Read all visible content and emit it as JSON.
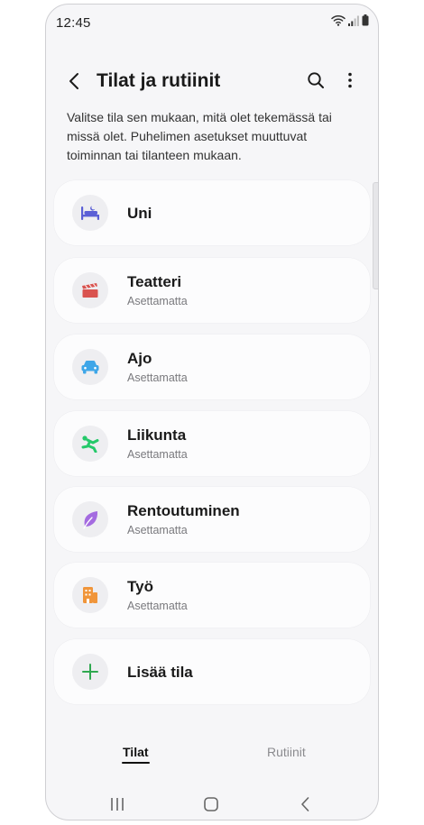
{
  "status_bar": {
    "time": "12:45",
    "icons": [
      "wifi-icon",
      "signal-icon",
      "battery-icon"
    ]
  },
  "header": {
    "title": "Tilat ja rutiinit",
    "back_icon": "back-arrow-icon",
    "search_icon": "search-icon",
    "more_icon": "more-vertical-icon"
  },
  "description": "Valitse tila sen mukaan, mitä olet tekemässä tai missä olet. Puhelimen asetukset muuttuvat toiminnan tai tilanteen mukaan.",
  "modes": [
    {
      "name": "Uni",
      "subtitle": "",
      "icon": "bed-icon",
      "color": "#5a5fd6"
    },
    {
      "name": "Teatteri",
      "subtitle": "Asettamatta",
      "icon": "clapperboard-icon",
      "color": "#d9534f"
    },
    {
      "name": "Ajo",
      "subtitle": "Asettamatta",
      "icon": "car-icon",
      "color": "#3ea6e8"
    },
    {
      "name": "Liikunta",
      "subtitle": "Asettamatta",
      "icon": "running-icon",
      "color": "#25c96a"
    },
    {
      "name": "Rentoutuminen",
      "subtitle": "Asettamatta",
      "icon": "leaf-icon",
      "color": "#a46be0"
    },
    {
      "name": "Työ",
      "subtitle": "Asettamatta",
      "icon": "building-icon",
      "color": "#f0953a"
    }
  ],
  "add_mode": {
    "label": "Lisää tila",
    "icon": "plus-icon",
    "color": "#2fa84f"
  },
  "tabs": [
    {
      "label": "Tilat",
      "active": true
    },
    {
      "label": "Rutiinit",
      "active": false
    }
  ],
  "nav_bar": {
    "icons": [
      "recents-icon",
      "home-icon",
      "back-icon"
    ]
  }
}
